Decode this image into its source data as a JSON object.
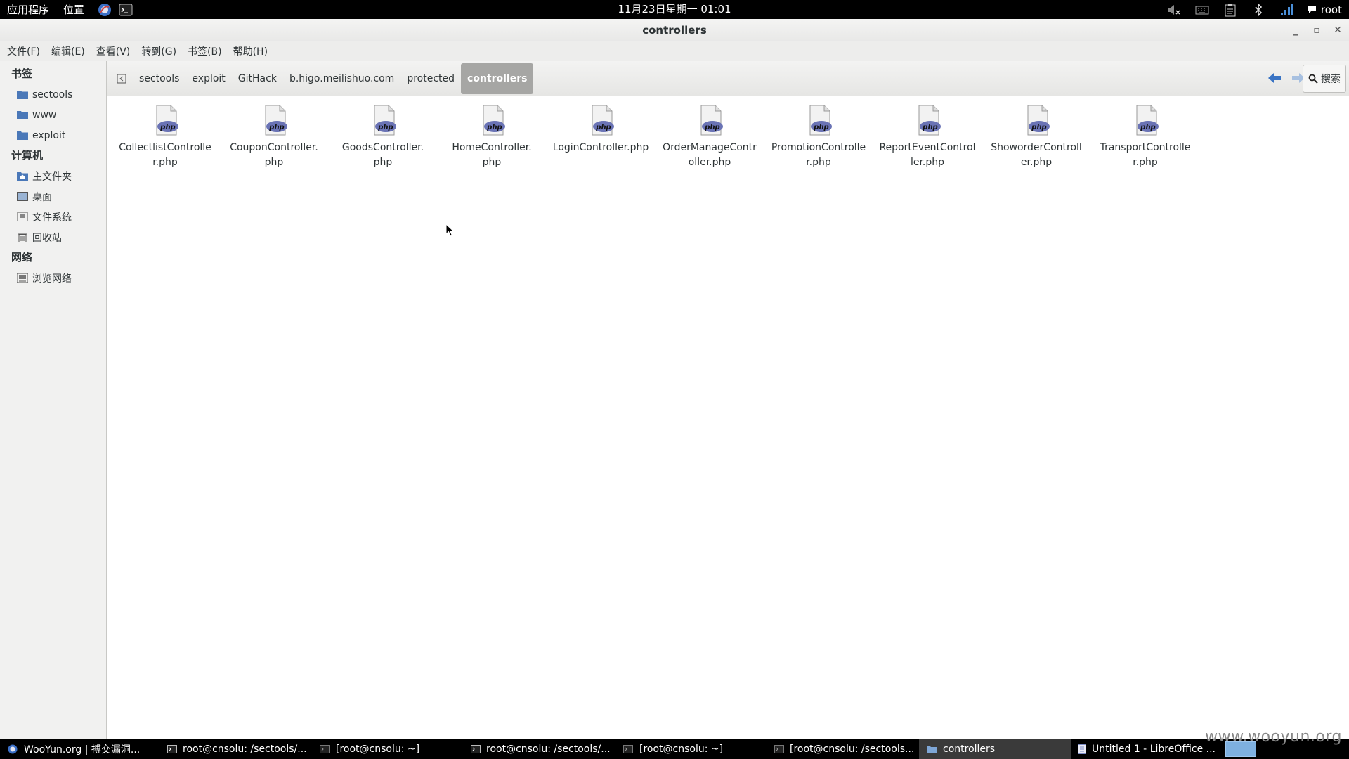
{
  "top_panel": {
    "menus": [
      "应用程序",
      "位置"
    ],
    "clock": "11月23日星期一 01:01",
    "user": "root"
  },
  "window": {
    "title": "controllers"
  },
  "menubar": [
    "文件(F)",
    "编辑(E)",
    "查看(V)",
    "转到(G)",
    "书签(B)",
    "帮助(H)"
  ],
  "sidebar": {
    "bookmarks_heading": "书签",
    "bookmarks": [
      "sectools",
      "www",
      "exploit"
    ],
    "computer_heading": "计算机",
    "computer": [
      "主文件夹",
      "桌面",
      "文件系统",
      "回收站"
    ],
    "network_heading": "网络",
    "network": [
      "浏览网络"
    ]
  },
  "pathbar": {
    "crumbs": [
      "sectools",
      "exploit",
      "GitHack",
      "b.higo.meilishuo.com",
      "protected",
      "controllers"
    ],
    "search_label": "搜索"
  },
  "files": [
    "CollectlistController.php",
    "CouponController.php",
    "GoodsController.php",
    "HomeController.php",
    "LoginController.php",
    "OrderManageController.php",
    "PromotionController.php",
    "ReportEventController.php",
    "ShoworderController.php",
    "TransportController.php"
  ],
  "file_label_lines": [
    [
      "CollectlistControlle",
      "r.php"
    ],
    [
      "CouponController.",
      "php"
    ],
    [
      "GoodsController.",
      "php"
    ],
    [
      "HomeController.",
      "php"
    ],
    [
      "LoginController.php"
    ],
    [
      "OrderManageContr",
      "oller.php"
    ],
    [
      "PromotionControlle",
      "r.php"
    ],
    [
      "ReportEventControl",
      "ler.php"
    ],
    [
      "ShoworderControll",
      "er.php"
    ],
    [
      "TransportControlle",
      "r.php"
    ]
  ],
  "taskbar": [
    "WooYun.org | 搏交漏洞...",
    "root@cnsolu: /sectools/...",
    "[root@cnsolu: ~]",
    "root@cnsolu: /sectools/...",
    "[root@cnsolu: ~]",
    "[root@cnsolu: /sectools...",
    "controllers",
    "Untitled 1 - LibreOffice ..."
  ],
  "watermark": "www.wooyun.org",
  "colors": {
    "panel_bg": "#000000",
    "active_crumb": "#a6a6a4",
    "folder_icon": "#4a78b8",
    "nav_arrow": "#3a74c4"
  }
}
